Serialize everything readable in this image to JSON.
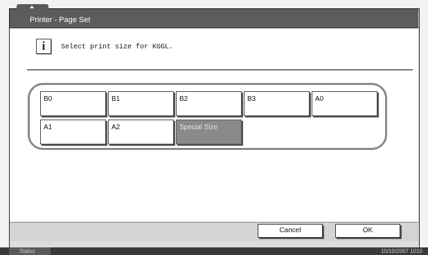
{
  "window": {
    "title": "Printer - Page Set"
  },
  "message": {
    "text": "Select print size for KGGL.",
    "icon": "info-icon"
  },
  "sizes": [
    {
      "label": "B0",
      "selected": false
    },
    {
      "label": "B1",
      "selected": false
    },
    {
      "label": "B2",
      "selected": false
    },
    {
      "label": "B3",
      "selected": false
    },
    {
      "label": "A0",
      "selected": false
    },
    {
      "label": "A1",
      "selected": false
    },
    {
      "label": "A2",
      "selected": false
    },
    {
      "label": "Special Size",
      "selected": true
    }
  ],
  "footer": {
    "cancel_label": "Cancel",
    "ok_label": "OK"
  },
  "statusbar": {
    "status_label": "Status",
    "datetime": "10/10/2007   1010"
  },
  "colors": {
    "titlebar": "#5c5c5c",
    "selected_button": "#8a8a8a",
    "group_border": "#8a8a8a"
  }
}
